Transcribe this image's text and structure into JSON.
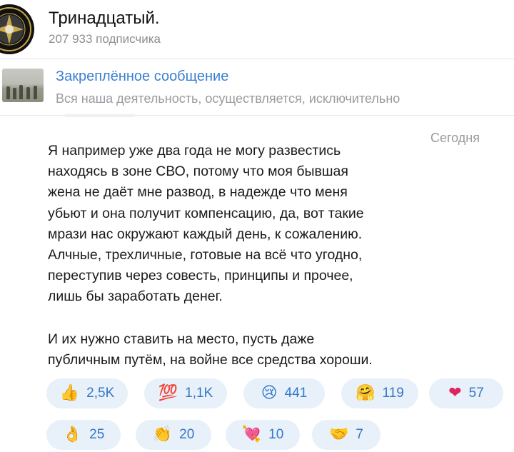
{
  "channel": {
    "title": "Тринадцатый.",
    "subscribers": "207 933 подписчика"
  },
  "pinned": {
    "label": "Закреплённое сообщение",
    "preview": "Вся наша деятельность, осуществляется, исключительно"
  },
  "message": {
    "date": "Сегодня",
    "paragraph1_lines": [
      "Я например уже два года не могу развестись",
      "находясь в зоне СВО, потому что моя бывшая",
      "жена не даёт мне развод, в надежде что меня",
      "убьют и она получит компенсацию, да, вот такие",
      "мрази нас окружают каждый день, к сожалению.",
      "Алчные, трехличные, готовые на всё что угодно,",
      "переступив через совесть, принципы и прочее,",
      "лишь бы заработать денег."
    ],
    "paragraph2_lines": [
      "И их нужно ставить на место, пусть даже",
      "публичным путём, на войне все средства хороши."
    ]
  },
  "reactions": [
    {
      "icon": "thumbs-up-icon",
      "emoji": "👍",
      "count": "2,5K"
    },
    {
      "icon": "hundred-points-icon",
      "emoji": "💯",
      "count": "1,1K"
    },
    {
      "icon": "crying-face-icon",
      "emoji": "😢",
      "count": "441"
    },
    {
      "icon": "hugging-face-icon",
      "emoji": "🤗",
      "count": "119"
    },
    {
      "icon": "red-heart-icon",
      "emoji": "❤",
      "count": "57"
    },
    {
      "icon": "ok-hand-icon",
      "emoji": "👌",
      "count": "25"
    },
    {
      "icon": "clapping-hands-icon",
      "emoji": "👏",
      "count": "20"
    },
    {
      "icon": "heart-with-arrow-icon",
      "emoji": "💘",
      "count": "10"
    },
    {
      "icon": "handshake-icon",
      "emoji": "🤝",
      "count": "7"
    }
  ],
  "colors": {
    "accent": "#3a7fd1",
    "reaction_bg": "#e8f0fa",
    "muted_text": "#9a9aa0"
  }
}
